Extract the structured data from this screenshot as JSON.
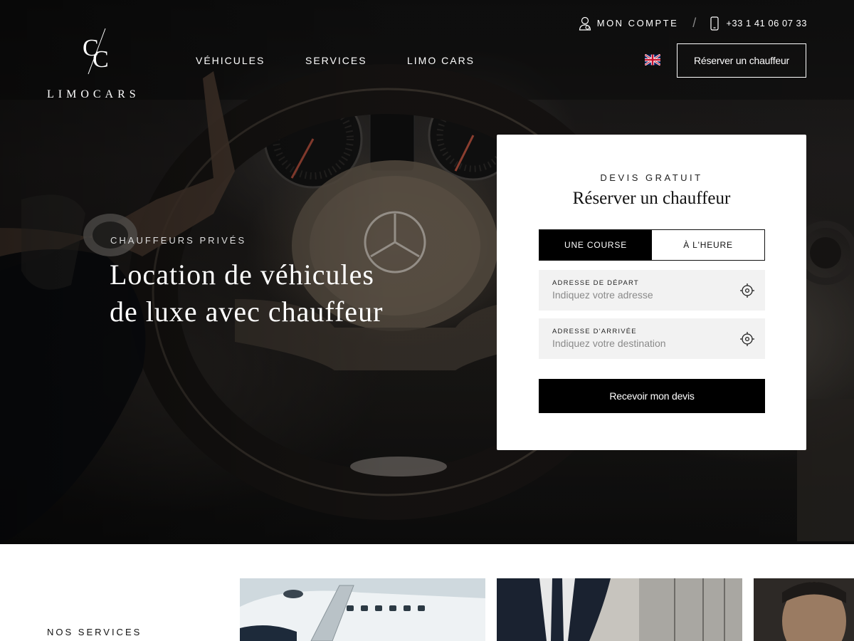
{
  "brand": {
    "name": "LIMOCARS",
    "monogram": "CC"
  },
  "header": {
    "account_label": "MON COMPTE",
    "separator": "/",
    "phone": "+33 1 41 06 07 33",
    "nav": [
      {
        "label": "VÉHICULES"
      },
      {
        "label": "SERVICES"
      },
      {
        "label": "LIMO CARS"
      }
    ],
    "language_flag": "uk-flag-icon",
    "reserve_button": "Réserver un chauffeur"
  },
  "hero": {
    "eyebrow": "CHAUFFEURS PRIVÉS",
    "title_line1": "Location de véhicules",
    "title_line2": "de luxe avec chauffeur"
  },
  "booking": {
    "eyebrow": "DEVIS GRATUIT",
    "title": "Réserver un chauffeur",
    "tabs": [
      {
        "label": "UNE COURSE",
        "active": true
      },
      {
        "label": "À L'HEURE",
        "active": false
      }
    ],
    "departure": {
      "label": "ADRESSE DE DÉPART",
      "placeholder": "Indiquez votre adresse",
      "value": ""
    },
    "arrival": {
      "label": "ADRESSE D'ARRIVÉE",
      "placeholder": "Indiquez votre destination",
      "value": ""
    },
    "submit": "Recevoir mon devis"
  },
  "services": {
    "label": "NOS SERVICES"
  },
  "colors": {
    "primary": "#000000",
    "card_bg": "#ffffff",
    "field_bg": "#f2f2f2"
  }
}
